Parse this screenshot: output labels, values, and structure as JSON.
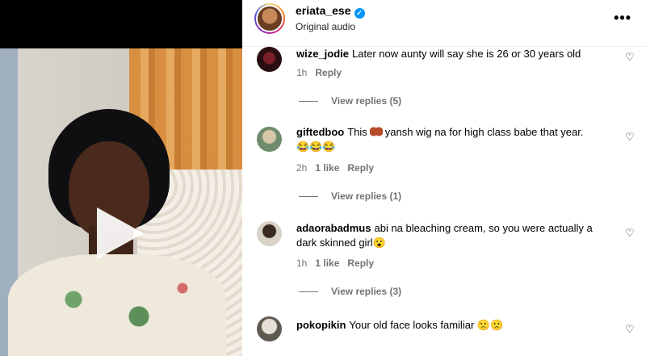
{
  "post": {
    "username": "eriata_ese",
    "verified_mark": "✓",
    "audio": "Original audio",
    "more": "•••"
  },
  "comments": [
    {
      "username": "wize_jodie",
      "text": "Later now aunty will say she is 26 or 30 years old",
      "time": "1h",
      "likes": "",
      "reply": "Reply",
      "view_replies": "View replies (5)"
    },
    {
      "username": "giftedboo",
      "text_before": "This",
      "text_after": "yansh wig na for high class babe that year.",
      "emojis": "😂😂😂",
      "time": "2h",
      "likes": "1 like",
      "reply": "Reply",
      "view_replies": "View replies (1)"
    },
    {
      "username": "adaorabadmus",
      "text": "abi na bleaching cream, so you were actually a dark skinned girl😮",
      "time": "1h",
      "likes": "1 like",
      "reply": "Reply",
      "view_replies": "View replies (3)"
    },
    {
      "username": "pokopikin",
      "text": "Your old face looks familiar 🙁🙁"
    }
  ],
  "icons": {
    "heart": "♡",
    "play": "play-icon"
  },
  "colors": {
    "accent": "#0095f6",
    "muted": "#737373"
  }
}
